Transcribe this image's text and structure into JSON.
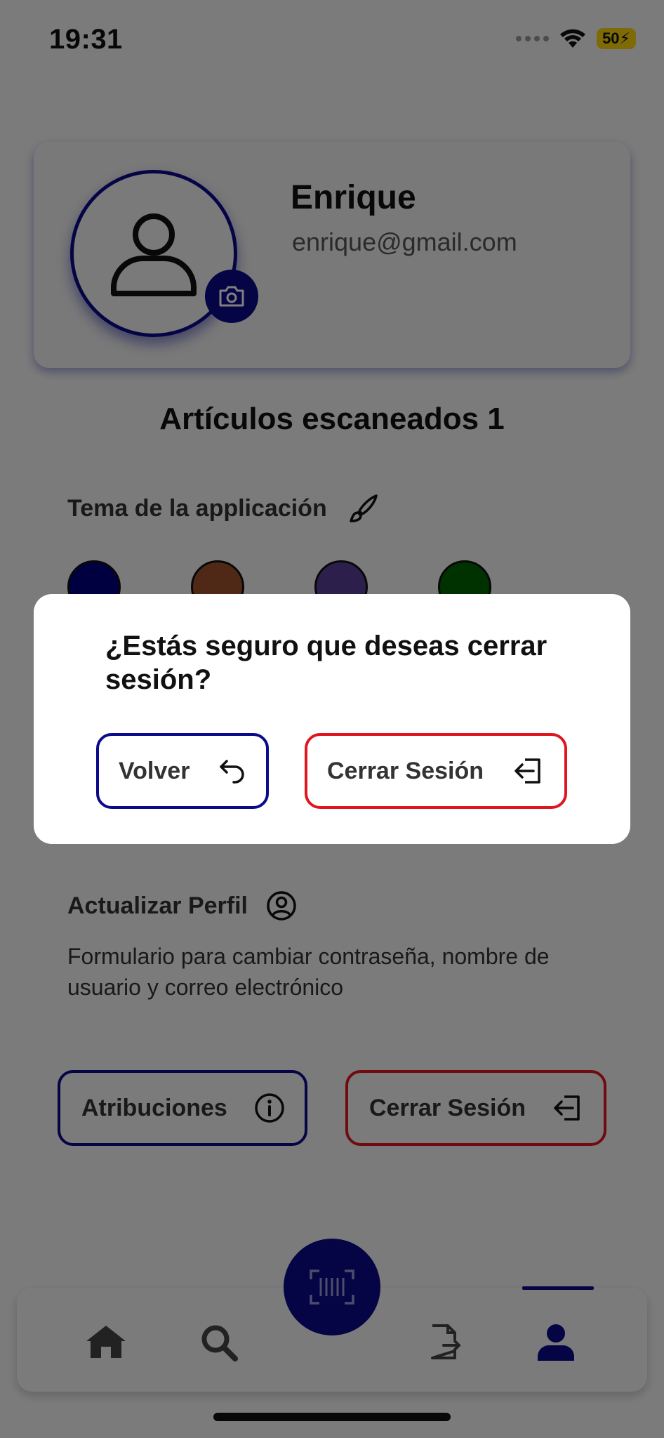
{
  "status_bar": {
    "time": "19:31",
    "battery": "50"
  },
  "profile": {
    "name": "Enrique",
    "email": "enrique@gmail.com"
  },
  "scanned": {
    "label": "Artículos escaneados 1"
  },
  "theme": {
    "title": "Tema de la applicación",
    "colors": [
      "#000080",
      "#a0522d",
      "#5b3f99",
      "#006400"
    ]
  },
  "update_profile": {
    "title": "Actualizar Perfil",
    "description": "Formulario para cambiar contraseña, nombre de usuario y correo electrónico"
  },
  "actions": {
    "attributions_label": "Atribuciones",
    "logout_label": "Cerrar Sesión"
  },
  "modal": {
    "question": "¿Estás seguro que deseas cerrar sesión?",
    "back_label": "Volver",
    "logout_label": "Cerrar Sesión"
  },
  "tabbar": {
    "active_tab": "profile"
  },
  "colors": {
    "primary": "#0a0a8a",
    "danger": "#e0161e",
    "battery": "#ffd60a"
  }
}
